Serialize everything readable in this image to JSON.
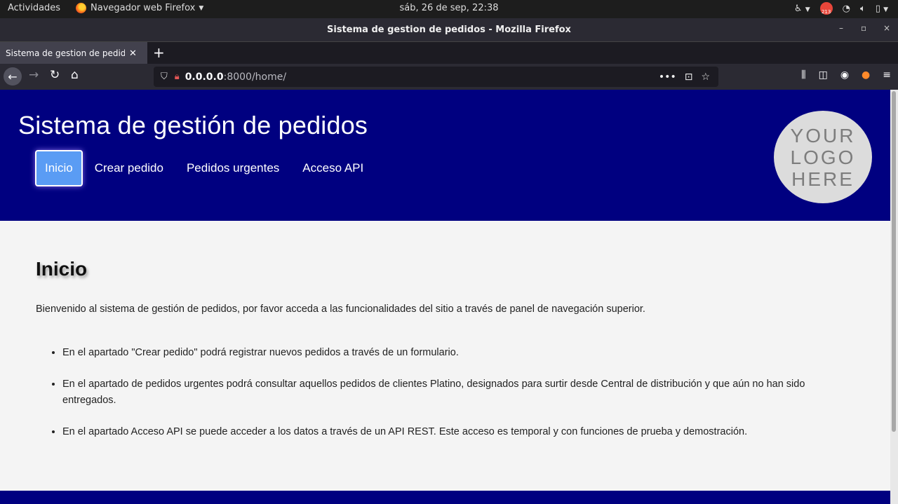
{
  "system_bar": {
    "activities": "Actividades",
    "app_menu": "Navegador web Firefox",
    "clock": "sáb, 26 de sep, 22:38",
    "notification_count": "213"
  },
  "window": {
    "title": "Sistema de gestion de pedidos - Mozilla Firefox"
  },
  "tabs": [
    {
      "label": "Sistema de gestion de pedidos"
    }
  ],
  "urlbar": {
    "host": "0.0.0.0",
    "path": ":8000/home/"
  },
  "site": {
    "title": "Sistema de gestión de pedidos",
    "nav": [
      {
        "label": "Inicio",
        "active": true
      },
      {
        "label": "Crear pedido",
        "active": false
      },
      {
        "label": "Pedidos urgentes",
        "active": false
      },
      {
        "label": "Acceso API",
        "active": false
      }
    ],
    "logo_lines": [
      "YOUR",
      "LOGO",
      "HERE"
    ],
    "colors": {
      "header": "#000080",
      "active_nav": "#5a9cf4",
      "background": "#f4f4f4"
    }
  },
  "content": {
    "heading": "Inicio",
    "intro": "Bienvenido al sistema de gestión de pedidos, por favor acceda a las funcionalidades del sitio a través de panel de navegación superior.",
    "items": [
      "En el apartado \"Crear pedido\" podrá registrar nuevos pedidos a través de un formulario.",
      "En el apartado de pedidos urgentes podrá consultar aquellos pedidos de clientes Platino, designados para surtir desde Central de distribución y que aún no han sido entregados.",
      "En el apartado Acceso API se puede acceder a los datos a través de un API REST. Este acceso es temporal y con funciones de prueba y demostración."
    ]
  }
}
